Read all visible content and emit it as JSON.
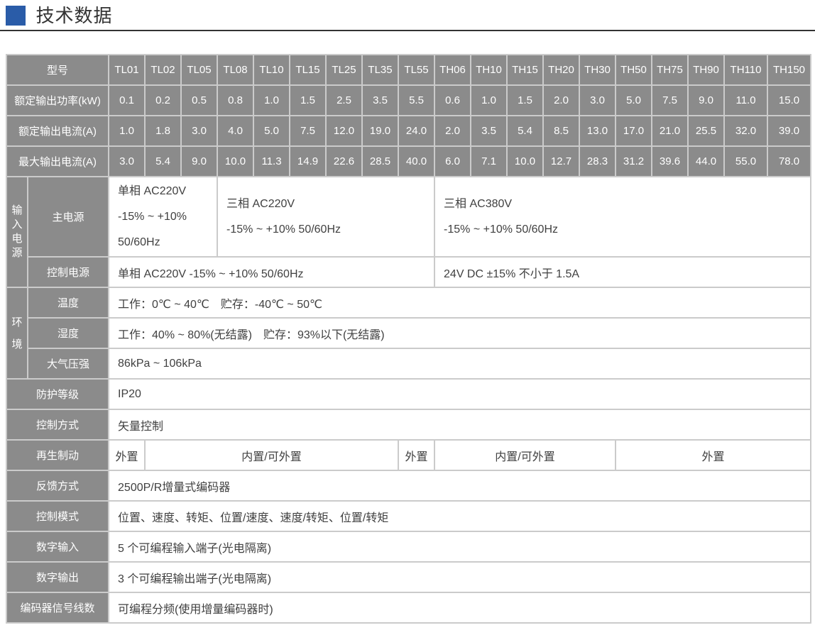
{
  "title": {
    "text": "技术数据"
  },
  "colors": {
    "accent_blue": "#2a5ca8",
    "header_gray": "#8b8b8b",
    "grid_border": "#cbcbcb",
    "content_text": "#404040"
  },
  "table": {
    "model_row": {
      "label": "型号",
      "models": [
        "TL01",
        "TL02",
        "TL05",
        "TL08",
        "TL10",
        "TL15",
        "TL25",
        "TL35",
        "TL55",
        "TH06",
        "TH10",
        "TH15",
        "TH20",
        "TH30",
        "TH50",
        "TH75",
        "TH90",
        "TH110",
        "TH150"
      ]
    },
    "spec_rows": [
      {
        "label": "额定输出功率(kW)",
        "values": [
          "0.1",
          "0.2",
          "0.5",
          "0.8",
          "1.0",
          "1.5",
          "2.5",
          "3.5",
          "5.5",
          "0.6",
          "1.0",
          "1.5",
          "2.0",
          "3.0",
          "5.0",
          "7.5",
          "9.0",
          "11.0",
          "15.0"
        ]
      },
      {
        "label": "额定输出电流(A)",
        "values": [
          "1.0",
          "1.8",
          "3.0",
          "4.0",
          "5.0",
          "7.5",
          "12.0",
          "19.0",
          "24.0",
          "2.0",
          "3.5",
          "5.4",
          "8.5",
          "13.0",
          "17.0",
          "21.0",
          "25.5",
          "32.0",
          "39.0"
        ]
      },
      {
        "label": "最大输出电流(A)",
        "values": [
          "3.0",
          "5.4",
          "9.0",
          "10.0",
          "11.3",
          "14.9",
          "22.6",
          "28.5",
          "40.0",
          "6.0",
          "7.1",
          "10.0",
          "12.7",
          "28.3",
          "31.2",
          "39.6",
          "44.0",
          "55.0",
          "78.0"
        ]
      }
    ],
    "input_power": {
      "group": "输入电源",
      "main": {
        "label": "主电源",
        "cells": [
          {
            "lines": [
              "单相 AC220V",
              "-15% ~ +10%",
              "50/60Hz"
            ]
          },
          {
            "lines": [
              "三相 AC220V",
              "-15% ~ +10% 50/60Hz"
            ]
          },
          {
            "lines": [
              "三相 AC380V",
              "-15% ~ +10% 50/60Hz"
            ]
          }
        ]
      },
      "control": {
        "label": "控制电源",
        "cells": [
          {
            "text": "单相 AC220V -15% ~ +10% 50/60Hz"
          },
          {
            "text": "24V DC ±15% 不小于 1.5A"
          }
        ]
      }
    },
    "environment": {
      "group": "环境",
      "rows": [
        {
          "label": "温度",
          "text": "工作：0℃ ~ 40℃　贮存：-40℃ ~ 50℃"
        },
        {
          "label": "湿度",
          "text": "工作：40% ~ 80%(无结露)　贮存：93%以下(无结露)"
        },
        {
          "label": "大气压强",
          "text": "86kPa ~ 106kPa"
        }
      ]
    },
    "simple_rows_1": [
      {
        "label": "防护等级",
        "text": "IP20"
      },
      {
        "label": "控制方式",
        "text": "矢量控制"
      }
    ],
    "regen": {
      "label": "再生制动",
      "cells": [
        {
          "text": "外置"
        },
        {
          "text": "内置/可外置"
        },
        {
          "text": "外置"
        },
        {
          "text": "内置/可外置"
        },
        {
          "text": "外置"
        }
      ]
    },
    "simple_rows_2": [
      {
        "label": "反馈方式",
        "text": "2500P/R增量式编码器"
      },
      {
        "label": "控制模式",
        "text": "位置、速度、转矩、位置/速度、速度/转矩、位置/转矩"
      },
      {
        "label": "数字输入",
        "text": "5 个可编程输入端子(光电隔离)"
      },
      {
        "label": "数字输出",
        "text": "3 个可编程输出端子(光电隔离)"
      },
      {
        "label": "编码器信号线数",
        "text": "可编程分频(使用增量编码器时)"
      }
    ]
  }
}
